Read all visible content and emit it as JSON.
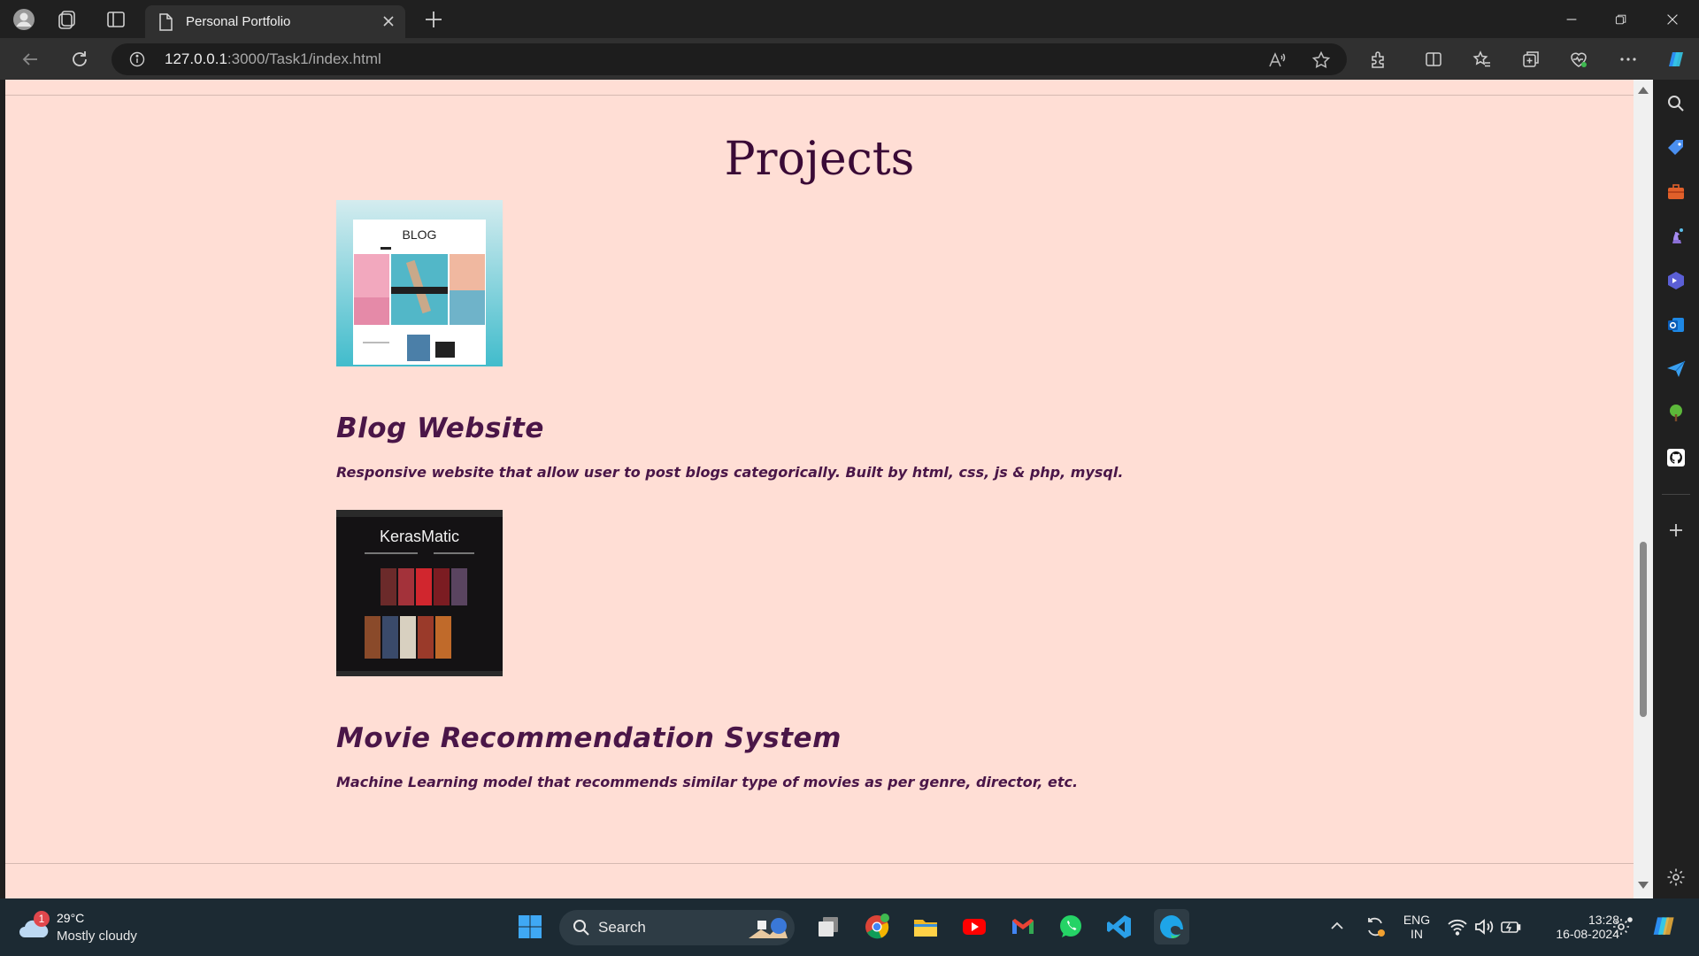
{
  "browser": {
    "tab_title": "Personal Portfolio",
    "url_host": "127.0.0.1",
    "url_rest": ":3000/Task1/index.html"
  },
  "page": {
    "section_title": "Projects",
    "projects": [
      {
        "name": "Blog Website",
        "description": "Responsive website that allow user to post blogs categorically. Built by html, css, js & php, mysql.",
        "thumb_text": "BLOG"
      },
      {
        "name": "Movie Recommendation System",
        "description": "Machine Learning model that recommends similar type of movies as per genre, director, etc.",
        "thumb_text": "KerasMatic"
      }
    ]
  },
  "taskbar": {
    "weather_temp": "29°C",
    "weather_desc": "Mostly cloudy",
    "weather_badge": "1",
    "search_label": "Search",
    "lang_top": "ENG",
    "lang_bottom": "IN",
    "time": "13:28",
    "date": "16-08-2024"
  },
  "colors": {
    "page_bg": "#ffded5",
    "heading": "#3a0a36",
    "project_text": "#4a1648"
  }
}
